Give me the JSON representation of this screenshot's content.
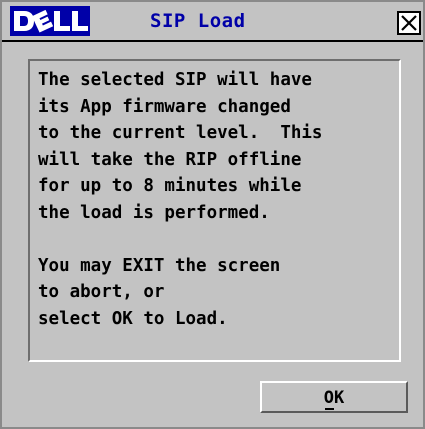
{
  "window": {
    "brand": "DELL",
    "title": "SIP Load",
    "close_icon": "close-icon"
  },
  "message": {
    "lines": [
      "The selected SIP will have",
      "its App firmware changed",
      "to the current level.  This",
      "will take the RIP offline",
      "for up to 8 minutes while",
      "the load is performed.",
      "",
      "You may EXIT the screen",
      "to abort, or",
      "select OK to Load."
    ]
  },
  "buttons": {
    "ok_label": "OK"
  },
  "colors": {
    "title_text": "#0000a8",
    "window_bg": "#c3c3c3",
    "text": "#000000"
  }
}
